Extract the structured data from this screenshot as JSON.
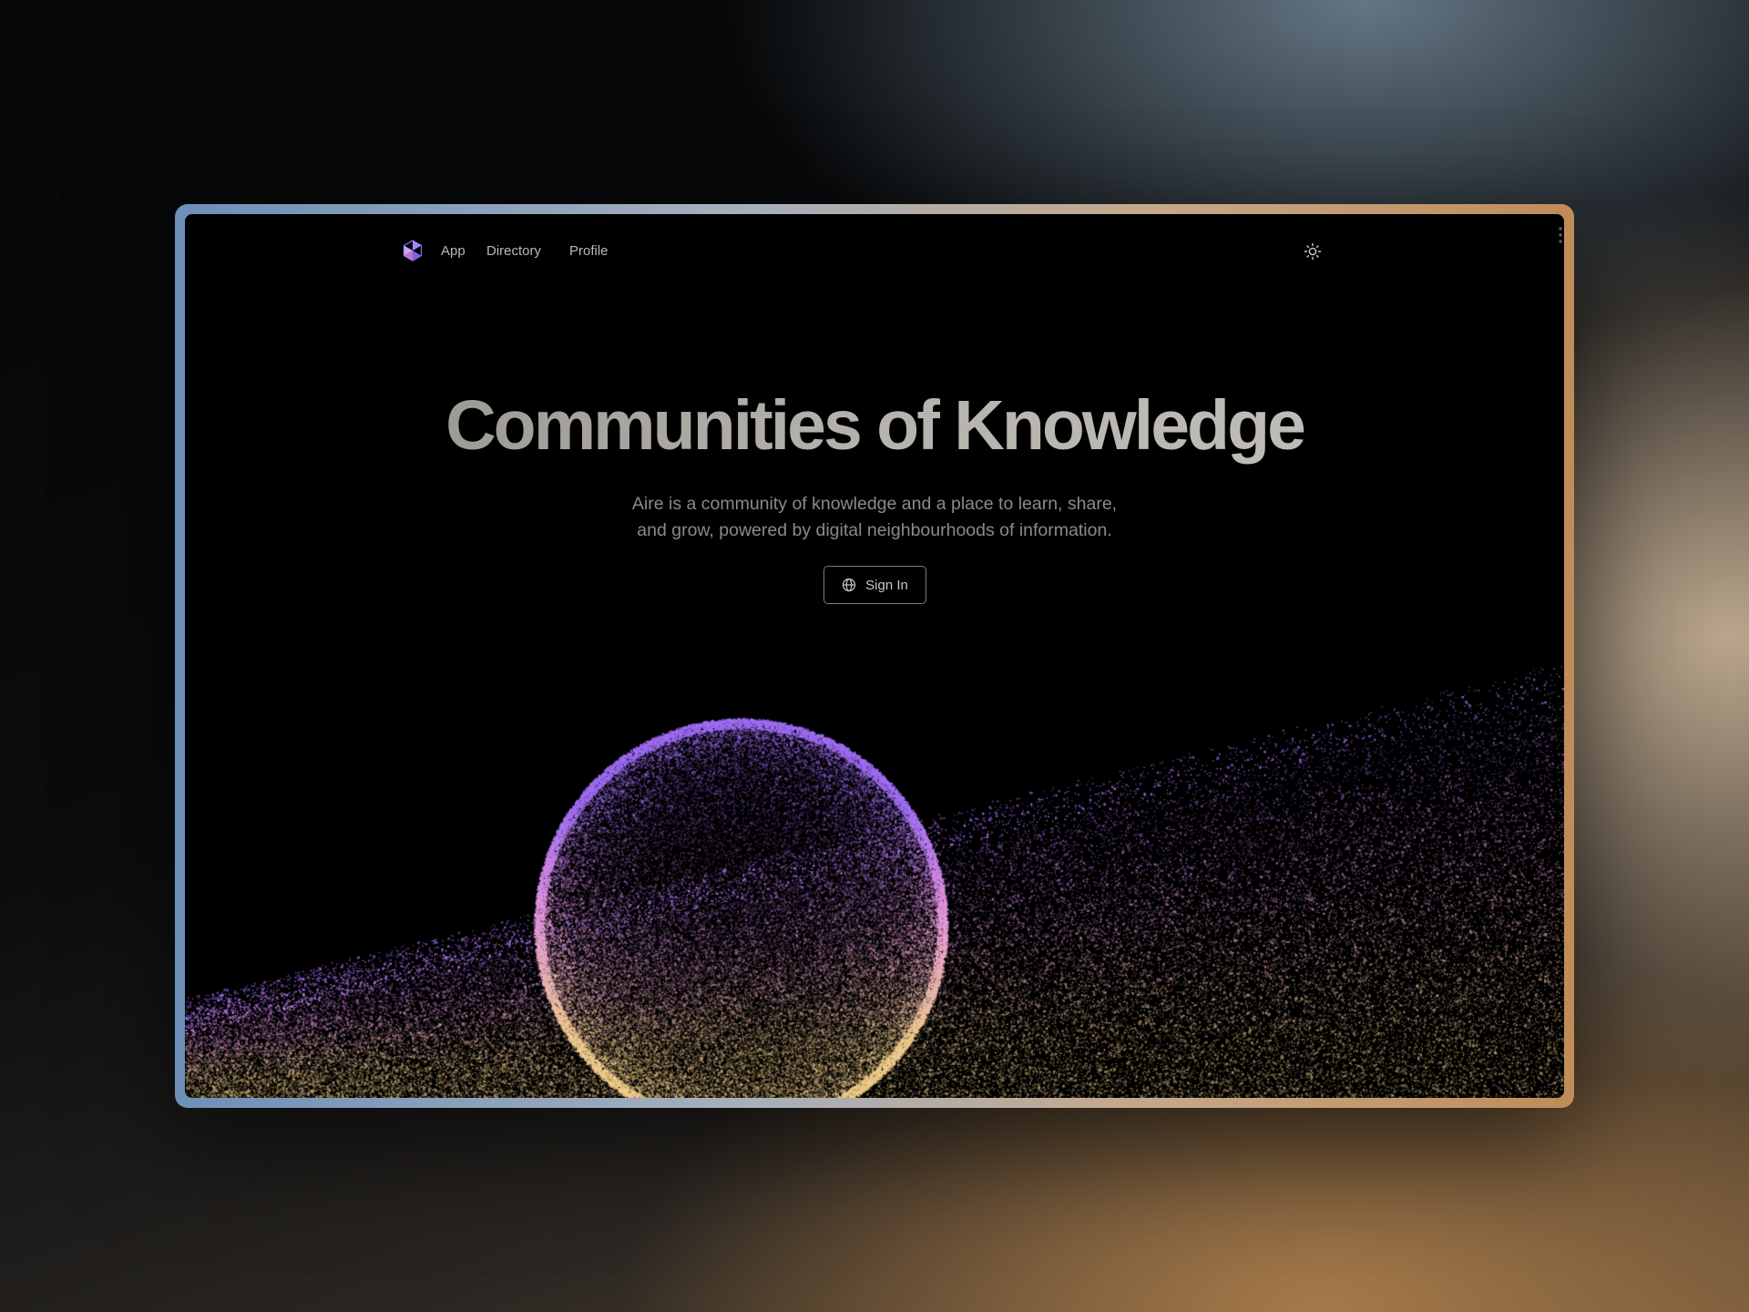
{
  "nav": {
    "logo_icon": "aire-logo-icon",
    "links": [
      {
        "label": "App"
      },
      {
        "label": "Directory"
      },
      {
        "label": "Profile"
      }
    ],
    "theme_icon": "sun-icon"
  },
  "hero": {
    "title": "Communities of Knowledge",
    "subtitle_line1": "Aire is a community of knowledge and a place to learn, share,",
    "subtitle_line2": "and grow, powered by digital neighbourhoods of information.",
    "signin_label": "Sign In",
    "signin_icon": "globe-icon"
  },
  "colors": {
    "accent_purple": "#9b6cf0",
    "accent_gold": "#e8c98a",
    "frame_blue": "#6d8fb8",
    "frame_gold": "#c08c58"
  }
}
